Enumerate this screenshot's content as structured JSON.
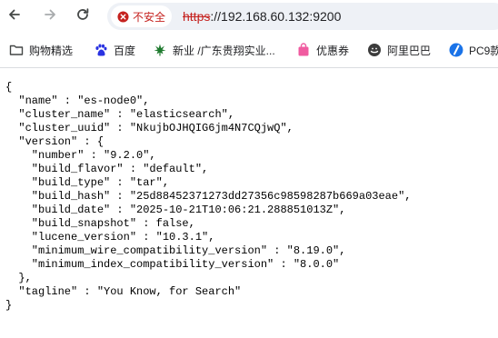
{
  "toolbar": {
    "back_icon": "arrow-left-icon",
    "forward_icon": "arrow-right-icon",
    "reload_icon": "reload-icon",
    "security": {
      "icon": "warning-circle-icon",
      "label": "不安全",
      "color": "#c5221f"
    },
    "url": {
      "scheme": "https",
      "rest": "://192.168.60.132:9200"
    }
  },
  "bookmarks": [
    {
      "icon": "folder-icon",
      "label": "购物精选"
    },
    {
      "icon": "baidu-paw-icon",
      "label": "百度"
    },
    {
      "icon": "cannabis-leaf-icon",
      "label": "新业 /广东贵翔实业..."
    },
    {
      "icon": "shopping-bag-icon",
      "label": "优惠券"
    },
    {
      "icon": "aliexpress-icon",
      "label": "阿里巴巴"
    },
    {
      "icon": "pc-logo-icon",
      "label": "PC9款"
    }
  ],
  "json_lines": [
    "{",
    "  \"name\" : \"es-node0\",",
    "  \"cluster_name\" : \"elasticsearch\",",
    "  \"cluster_uuid\" : \"NkujbOJHQIG6jm4N7CQjwQ\",",
    "  \"version\" : {",
    "    \"number\" : \"9.2.0\",",
    "    \"build_flavor\" : \"default\",",
    "    \"build_type\" : \"tar\",",
    "    \"build_hash\" : \"25d88452371273dd27356c98598287b669a03eae\",",
    "    \"build_date\" : \"2025-10-21T10:06:21.288851013Z\",",
    "    \"build_snapshot\" : false,",
    "    \"lucene_version\" : \"10.3.1\",",
    "    \"minimum_wire_compatibility_version\" : \"8.19.0\",",
    "    \"minimum_index_compatibility_version\" : \"8.0.0\"",
    "  },",
    "  \"tagline\" : \"You Know, for Search\"",
    "}"
  ]
}
